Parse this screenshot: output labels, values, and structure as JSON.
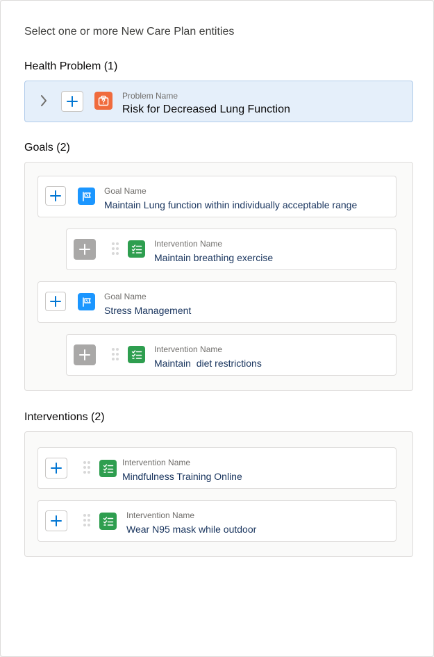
{
  "intro": "Select one or more New Care Plan entities",
  "health_problem": {
    "title": "Health Problem (1)",
    "label": "Problem Name",
    "value": "Risk for Decreased Lung Function"
  },
  "goals": {
    "title": "Goals (2)",
    "items": [
      {
        "label": "Goal Name",
        "value": "Maintain Lung function within individually acceptable range",
        "intervention": {
          "label": "Intervention Name",
          "value": "Maintain breathing exercise"
        }
      },
      {
        "label": "Goal Name",
        "value": "Stress Management",
        "intervention": {
          "label": "Intervention Name",
          "value": "Maintain  diet restrictions"
        }
      }
    ]
  },
  "interventions": {
    "title": "Interventions (2)",
    "items": [
      {
        "label": "Intervention Name",
        "value": "Mindfulness Training Online"
      },
      {
        "label": "Intervention Name",
        "value": "Wear N95 mask while outdoor"
      }
    ]
  },
  "icons": {
    "expand": "chevron-right-icon",
    "add": "plus-icon",
    "problem": "medical-kit-icon",
    "goal": "goal-flag-icon",
    "intervention": "checklist-icon",
    "drag": "drag-handle-icon"
  },
  "colors": {
    "accent": "#0176d3",
    "problem_icon": "#f06b3d",
    "goal_icon": "#1b96ff",
    "intervention_icon": "#2e9e4f",
    "selected_bg": "#e5effa",
    "value_text": "#16325c"
  }
}
